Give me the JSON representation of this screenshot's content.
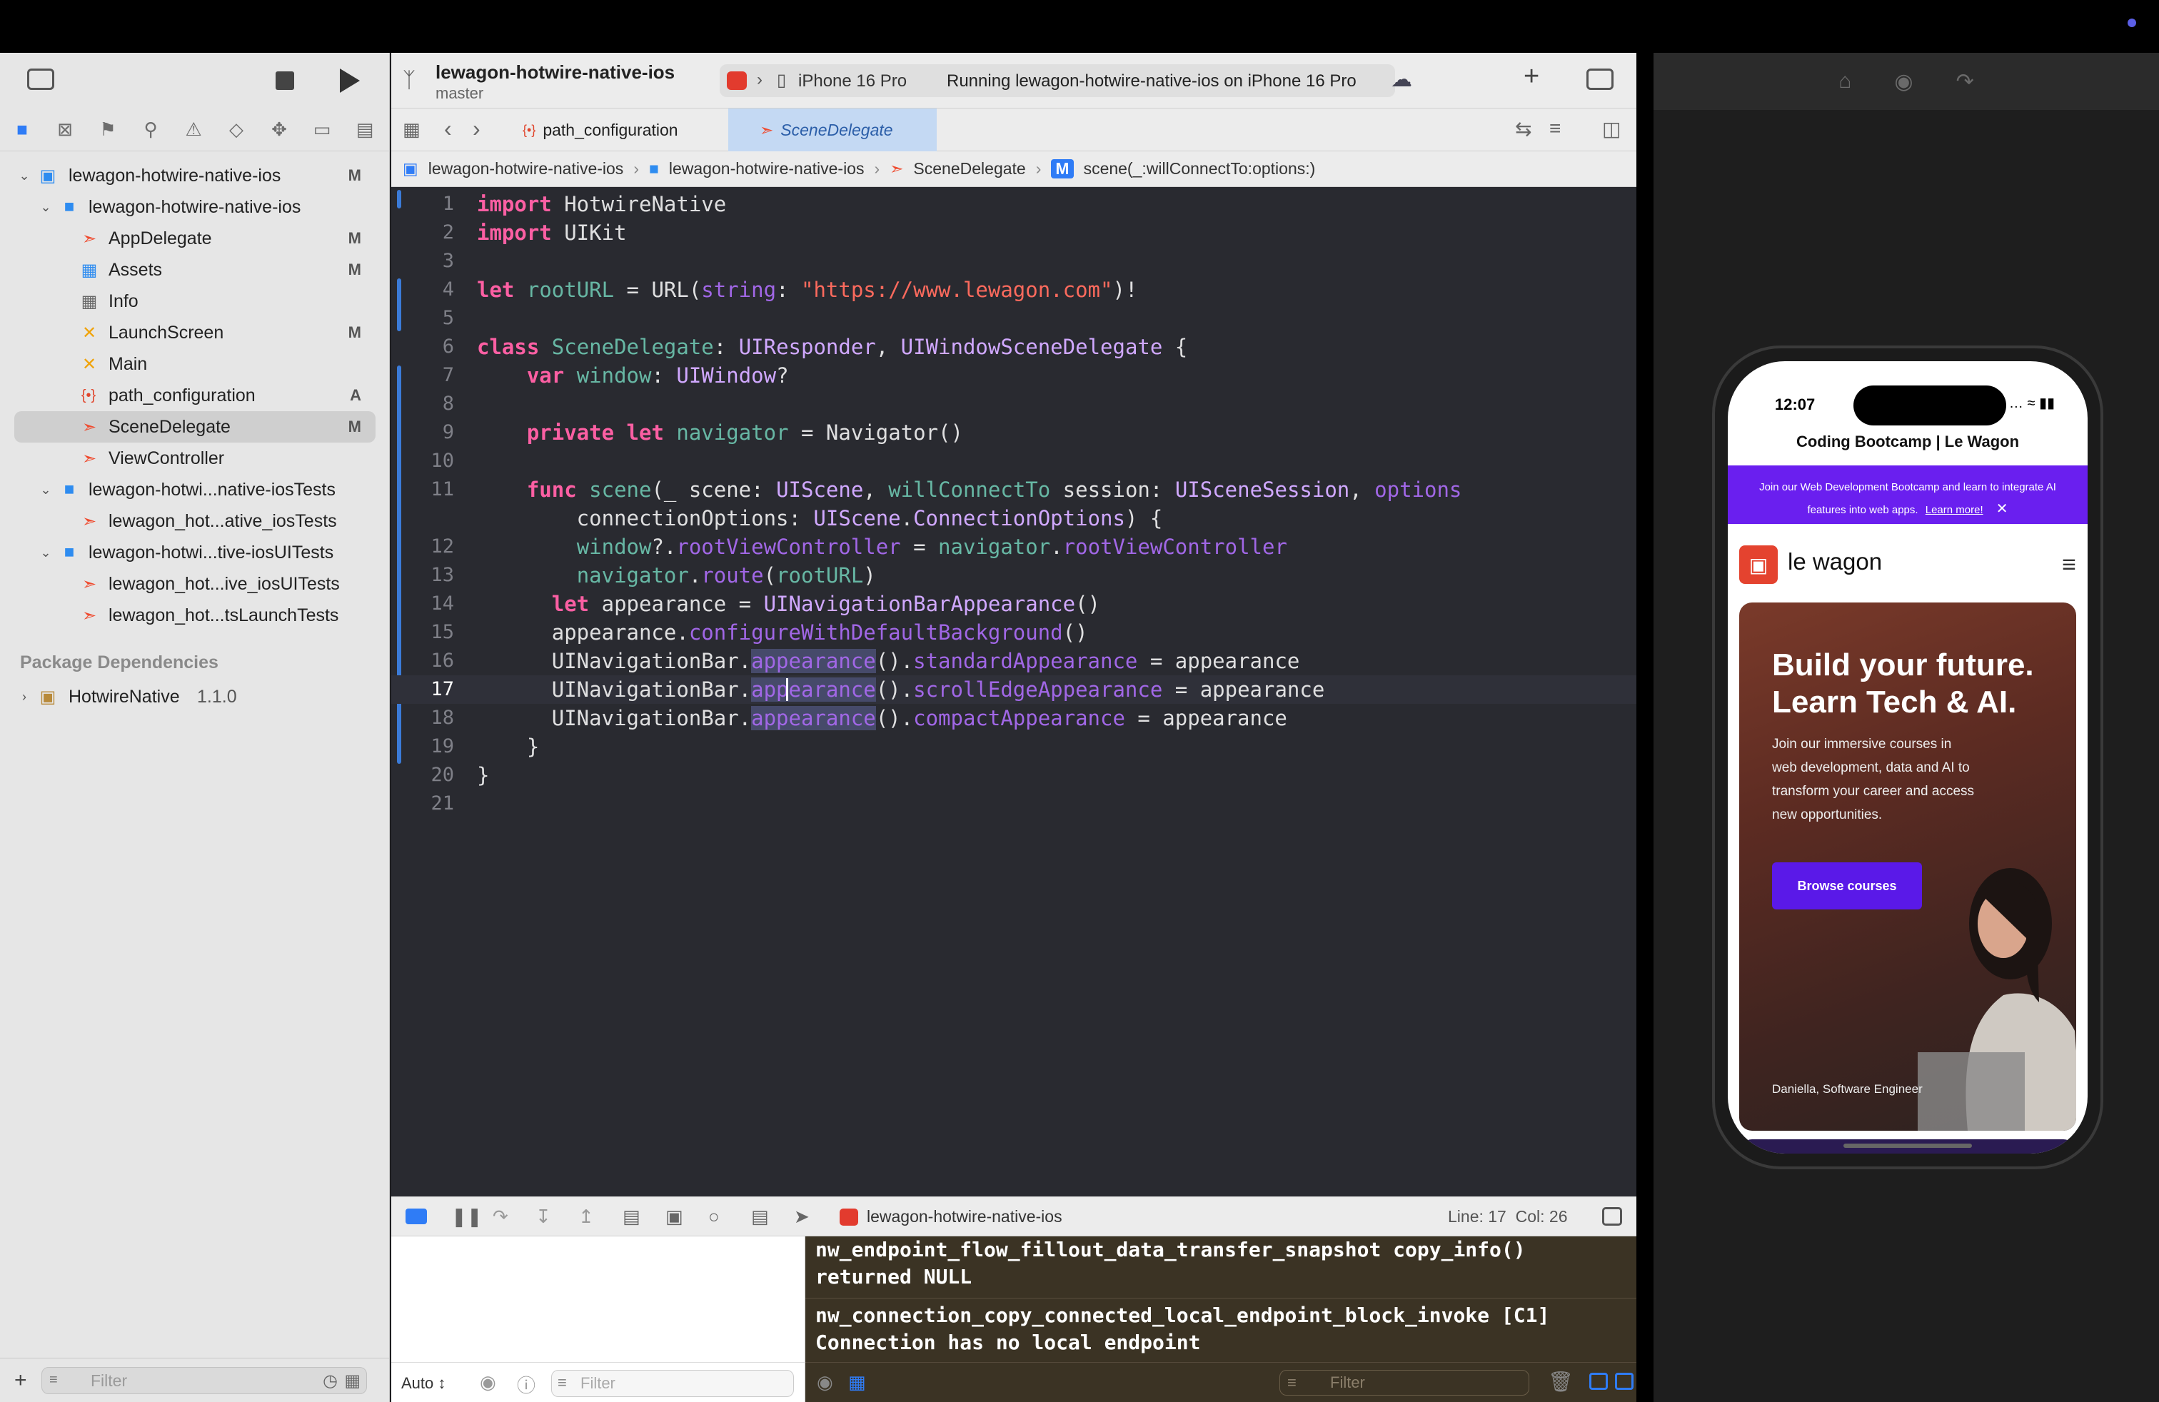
{
  "project": {
    "name": "lewagon-hotwire-native-ios",
    "branch": "master"
  },
  "toolbar": {
    "device": "iPhone 16 Pro",
    "status": "Running lewagon-hotwire-native-ios on iPhone 16 Pro",
    "add": "+"
  },
  "tabs": [
    {
      "label": "path_configuration",
      "icon": "json-icon"
    },
    {
      "label": "SceneDelegate",
      "icon": "swift-icon"
    }
  ],
  "jumpbar": [
    "lewagon-hotwire-native-ios",
    "lewagon-hotwire-native-ios",
    "SceneDelegate",
    "scene(_:willConnectTo:options:)"
  ],
  "navigator": {
    "items": [
      {
        "label": "lewagon-hotwire-native-ios",
        "badge": "M",
        "icon": "app-icon"
      },
      {
        "label": "lewagon-hotwire-native-ios",
        "badge": "",
        "icon": "folder-icon"
      },
      {
        "label": "AppDelegate",
        "badge": "M",
        "icon": "swift-icon"
      },
      {
        "label": "Assets",
        "badge": "M",
        "icon": "assets-icon"
      },
      {
        "label": "Info",
        "badge": "",
        "icon": "table-icon"
      },
      {
        "label": "LaunchScreen",
        "badge": "M",
        "icon": "storyboard-icon"
      },
      {
        "label": "Main",
        "badge": "",
        "icon": "storyboard-icon"
      },
      {
        "label": "path_configuration",
        "badge": "A",
        "icon": "json-icon"
      },
      {
        "label": "SceneDelegate",
        "badge": "M",
        "icon": "swift-icon"
      },
      {
        "label": "ViewController",
        "badge": "",
        "icon": "swift-icon"
      },
      {
        "label": "lewagon-hotwi...native-iosTests",
        "badge": "",
        "icon": "folder-icon"
      },
      {
        "label": "lewagon_hot...ative_iosTests",
        "badge": "",
        "icon": "swift-icon"
      },
      {
        "label": "lewagon-hotwi...tive-iosUITests",
        "badge": "",
        "icon": "folder-icon"
      },
      {
        "label": "lewagon_hot...ive_iosUITests",
        "badge": "",
        "icon": "swift-icon"
      },
      {
        "label": "lewagon_hot...tsLaunchTests",
        "badge": "",
        "icon": "swift-icon"
      }
    ],
    "package_header": "Package Dependencies",
    "package": {
      "label": "HotwireNative",
      "version": "1.1.0"
    },
    "filter_placeholder": "Filter"
  },
  "code": [
    "import HotwireNative",
    "import UIKit",
    "",
    "let rootURL = URL(string: \"https://www.lewagon.com\")!",
    "",
    "class SceneDelegate: UIResponder, UIWindowSceneDelegate {",
    "    var window: UIWindow?",
    "",
    "    private let navigator = Navigator()",
    "",
    "    func scene(_ scene: UIScene, willConnectTo session: UISceneSession, options",
    "        connectionOptions: UIScene.ConnectionOptions) {",
    "        window?.rootViewController = navigator.rootViewController",
    "        navigator.route(rootURL)",
    "      let appearance = UINavigationBarAppearance()",
    "      appearance.configureWithDefaultBackground()",
    "      UINavigationBar.appearance().standardAppearance = appearance",
    "      UINavigationBar.appearance().scrollEdgeAppearance = appearance",
    "      UINavigationBar.appearance().compactAppearance = appearance",
    "    }",
    "}",
    ""
  ],
  "line_numbers": [
    "1",
    "2",
    "3",
    "4",
    "5",
    "6",
    "7",
    "8",
    "9",
    "10",
    "11",
    "",
    "12",
    "13",
    "14",
    "15",
    "16",
    "17",
    "18",
    "19",
    "20",
    "21"
  ],
  "debug": {
    "scheme": "lewagon-hotwire-native-ios",
    "position": "Line: 17  Col: 26",
    "auto": "Auto ↕",
    "filter_placeholder": "Filter"
  },
  "console": [
    "nw_endpoint_flow_fillout_data_transfer_snapshot copy_info()\nreturned NULL",
    "nw_connection_copy_connected_local_endpoint_block_invoke [C1]\nConnection has no local endpoint"
  ],
  "phone": {
    "time": "12:07",
    "page_title": "Coding Bootcamp | Le Wagon",
    "banner": "Join our Web Development Bootcamp and learn to integrate AI features into web apps.",
    "banner_link": "Learn more!",
    "brand": "le wagon",
    "hero_title": "Build your future. Learn Tech & AI.",
    "hero_text": "Join our immersive courses in web development, data and AI to transform your career and access new opportunities.",
    "cta": "Browse courses",
    "caption": "Daniella, Software Engineer"
  }
}
